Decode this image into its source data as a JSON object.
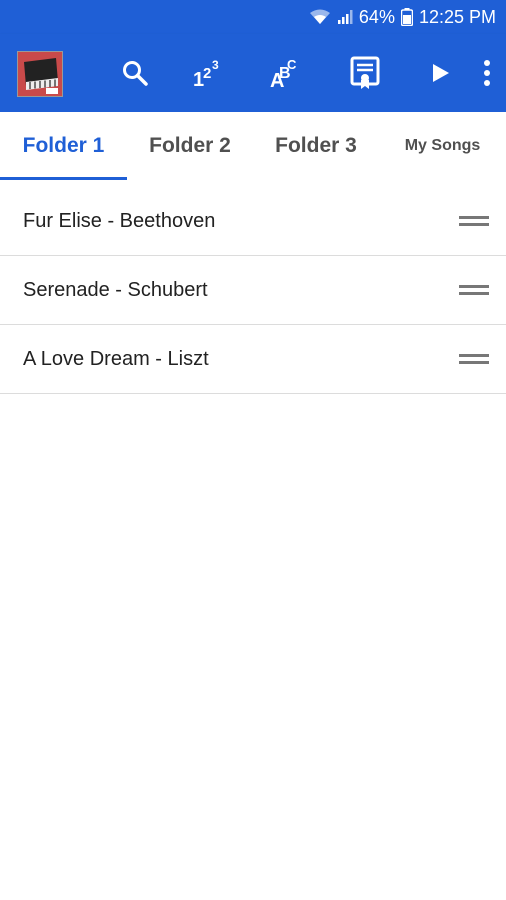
{
  "status": {
    "battery": "64%",
    "time": "12:25 PM"
  },
  "toolbar": {
    "icons": [
      "app-logo",
      "search-icon",
      "numbers-icon",
      "abc-icon",
      "certificate-icon",
      "play-icon",
      "more-vert-icon"
    ]
  },
  "tabs": [
    {
      "label": "Folder 1",
      "active": true
    },
    {
      "label": "Folder 2",
      "active": false
    },
    {
      "label": "Folder 3",
      "active": false
    },
    {
      "label": "My Songs",
      "active": false
    }
  ],
  "songs": [
    {
      "title": "Fur Elise - Beethoven"
    },
    {
      "title": "Serenade - Schubert"
    },
    {
      "title": "A Love Dream - Liszt"
    }
  ],
  "colors": {
    "accent": "#1f5fd6",
    "tab_inactive": "#505050",
    "divider": "#dcdcdc"
  }
}
